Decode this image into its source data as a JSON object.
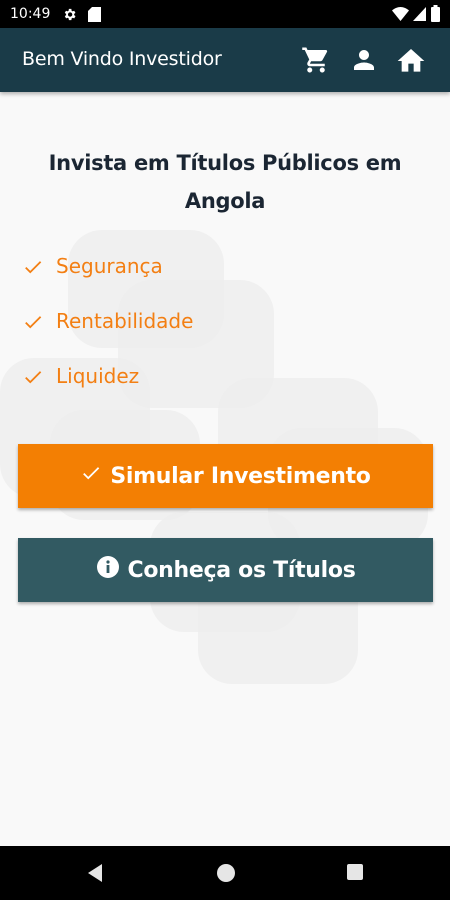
{
  "status_bar": {
    "time": "10:49",
    "icons": [
      "settings-icon",
      "sd-card-icon",
      "wifi-icon",
      "signal-icon",
      "battery-icon"
    ]
  },
  "app_bar": {
    "title": "Bem Vindo Investidor",
    "background": "#1a3b48",
    "actions": [
      "cart-icon",
      "person-icon",
      "home-icon"
    ]
  },
  "main": {
    "headline": "Invista em Títulos Públicos em Angola",
    "features": [
      "Segurança",
      "Rentabilidade",
      "Liquidez"
    ],
    "feature_color": "#f37f13",
    "primary_button": {
      "label": "Simular Investimento",
      "icon": "check-icon",
      "color": "#f37f03"
    },
    "secondary_button": {
      "label": "Conheça os Títulos",
      "icon": "info-icon",
      "color": "#325a62"
    }
  },
  "nav_bar": {
    "buttons": [
      "back-icon",
      "home-circle-icon",
      "recents-icon"
    ]
  }
}
